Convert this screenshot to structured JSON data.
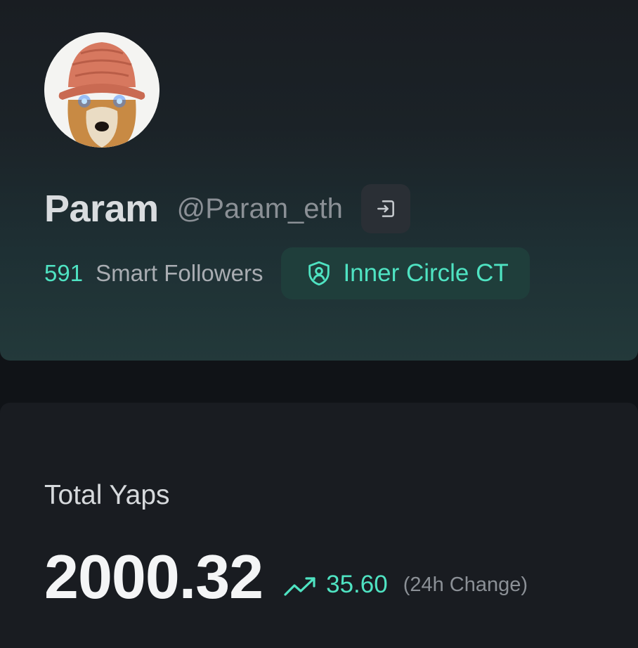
{
  "profile": {
    "avatar_icon": "dog-with-knit-hat-avatar",
    "display_name": "Param",
    "handle": "@Param_eth",
    "login_icon": "sign-in-icon",
    "smart_followers_count": "591",
    "smart_followers_label": "Smart Followers",
    "badge": {
      "icon": "shield-user-icon",
      "label": "Inner Circle CT"
    }
  },
  "stats": {
    "title": "Total Yaps",
    "value": "2000.32",
    "trend_icon": "trending-up-icon",
    "change": "35.60",
    "change_label": "(24h Change)"
  },
  "colors": {
    "accent": "#4fe3c2",
    "background": "#101317",
    "card": "#191c21",
    "badge_bg": "#1f3e3b",
    "muted_text": "#8b9096"
  }
}
